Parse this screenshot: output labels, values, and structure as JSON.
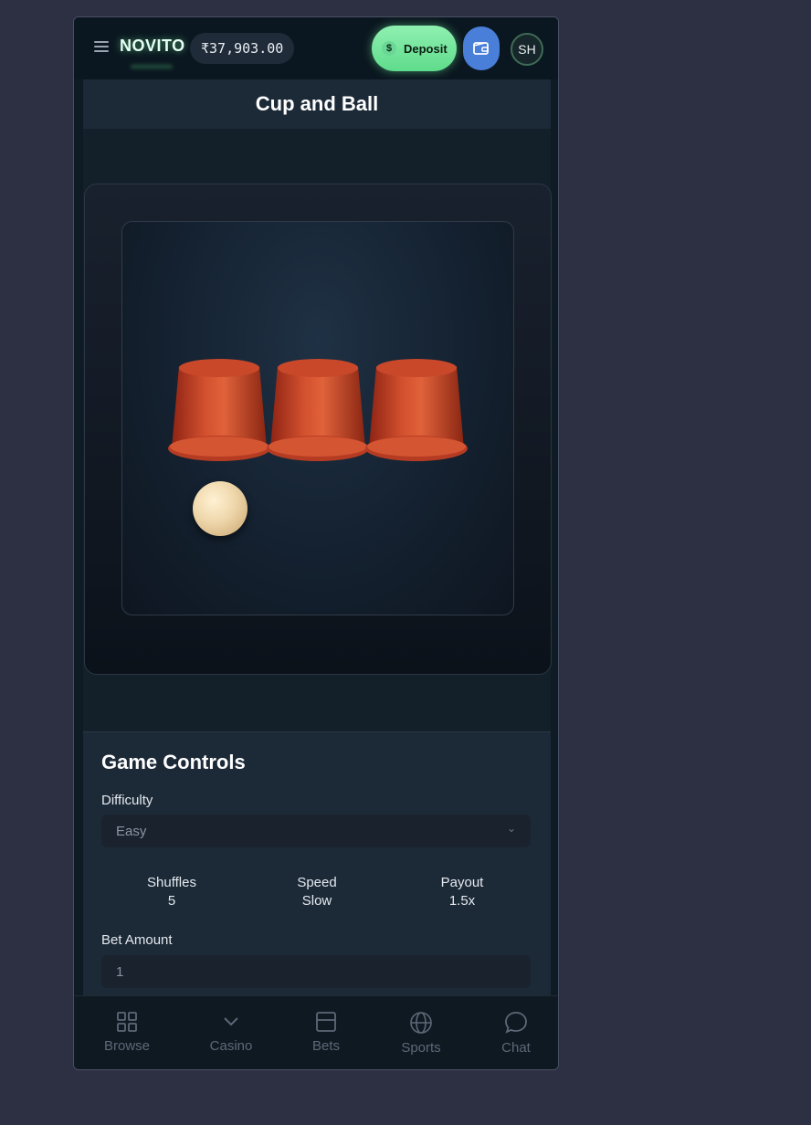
{
  "header": {
    "brand": "NOVITO",
    "balance": "₹37,903.00",
    "deposit_label": "Deposit",
    "deposit_icon": "$",
    "avatar_initials": "SH"
  },
  "game": {
    "title": "Cup and Ball",
    "cups": 3,
    "ball_position": 1
  },
  "controls": {
    "title": "Game Controls",
    "difficulty_label": "Difficulty",
    "difficulty_value": "Easy",
    "stats": [
      {
        "label": "Shuffles",
        "value": "5"
      },
      {
        "label": "Speed",
        "value": "Slow"
      },
      {
        "label": "Payout",
        "value": "1.5x"
      }
    ],
    "bet_label": "Bet Amount",
    "bet_value": "1"
  },
  "nav": [
    {
      "label": "Browse",
      "icon": "grid-icon"
    },
    {
      "label": "Casino",
      "icon": "chevron-down-icon"
    },
    {
      "label": "Bets",
      "icon": "ticket-icon"
    },
    {
      "label": "Sports",
      "icon": "globe-icon"
    },
    {
      "label": "Chat",
      "icon": "chat-bubble-icon"
    }
  ],
  "colors": {
    "accent_green": "#5fdc8c",
    "wallet_blue": "#4a7fd9",
    "cup_red": "#c8442a"
  }
}
